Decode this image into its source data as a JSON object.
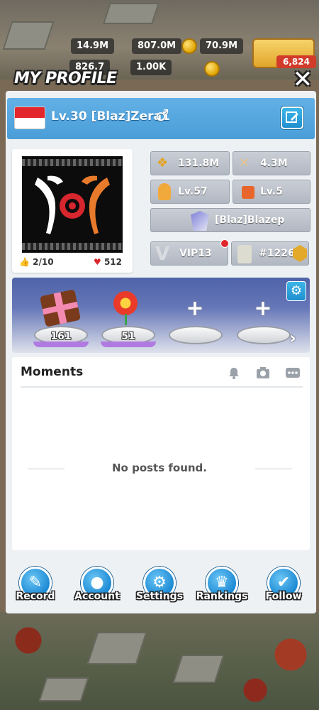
{
  "background": {
    "resources": [
      {
        "label": "14.9M"
      },
      {
        "label": "807.0M"
      },
      {
        "label": "70.9M"
      },
      {
        "label": "826.7"
      },
      {
        "label": "1.00K"
      },
      {
        "label": "6,824"
      }
    ]
  },
  "profile": {
    "title": "MY PROFILE",
    "close_icon": "close-icon",
    "player": {
      "level_name": "Lv.30 [Blaz]Zera1",
      "gender_symbol": "♂",
      "flag": "indonesia-flag"
    },
    "avatar": {
      "likes": "2/10",
      "hearts": "512"
    },
    "stats": {
      "power": "131.8M",
      "kills": "4.3M",
      "hero_level": "Lv.57",
      "building_level": "Lv.5",
      "alliance": "[Blaz]Blazep",
      "vip": "VIP13",
      "rank": "#1226"
    },
    "gifts": [
      {
        "name": "chocolate-gift",
        "count": "161"
      },
      {
        "name": "flower-gift",
        "count": "51"
      },
      {
        "name": "empty-slot",
        "count": ""
      },
      {
        "name": "empty-slot",
        "count": ""
      }
    ],
    "moments": {
      "title": "Moments",
      "empty_text": "No posts found."
    },
    "nav": [
      {
        "label": "Record",
        "icon": "record-icon"
      },
      {
        "label": "Account",
        "icon": "account-icon"
      },
      {
        "label": "Settings",
        "icon": "settings-icon"
      },
      {
        "label": "Rankings",
        "icon": "rankings-icon"
      },
      {
        "label": "Follow",
        "icon": "follow-icon"
      }
    ]
  },
  "colors": {
    "header_blue": "#4a9ed8",
    "nav_blue": "#1c8ad4",
    "panel_bg": "#eef1f4"
  }
}
